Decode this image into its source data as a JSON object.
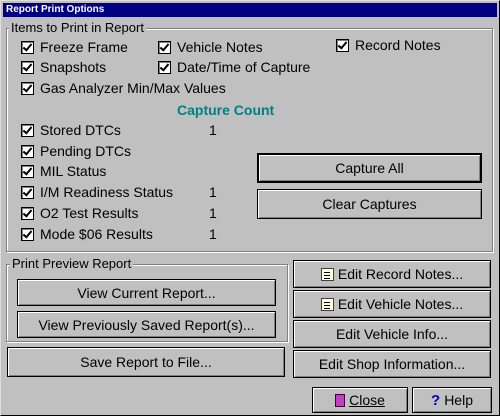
{
  "window": {
    "title": "Report Print Options"
  },
  "items_group": {
    "label": "Items to Print in Report",
    "freeze_frame": "Freeze Frame",
    "vehicle_notes": "Vehicle Notes",
    "record_notes": "Record Notes",
    "snapshots": "Snapshots",
    "date_time": "Date/Time of Capture",
    "gas_analyzer": "Gas Analyzer Min/Max Values",
    "capture_count_label": "Capture Count",
    "stored_dtcs": {
      "label": "Stored DTCs",
      "count": "1"
    },
    "pending_dtcs": {
      "label": "Pending DTCs",
      "count": ""
    },
    "mil_status": {
      "label": "MIL Status",
      "count": ""
    },
    "im_readiness": {
      "label": "I/M Readiness Status",
      "count": "1"
    },
    "o2_test": {
      "label": "O2 Test Results",
      "count": "1"
    },
    "mode06": {
      "label": "Mode $06 Results",
      "count": "1"
    },
    "capture_all": "Capture All",
    "clear_captures": "Clear Captures"
  },
  "preview_group": {
    "label": "Print Preview Report",
    "view_current": "View Current Report...",
    "view_saved": "View Previously Saved Report(s)..."
  },
  "buttons": {
    "save_to_file": "Save Report to File...",
    "edit_record_notes": "Edit Record Notes...",
    "edit_vehicle_notes": "Edit Vehicle Notes...",
    "edit_vehicle_info": "Edit Vehicle Info...",
    "edit_shop_info": "Edit Shop Information...",
    "close": "Close",
    "help": "Help"
  },
  "icons": {
    "note": "notepad-icon",
    "close": "door-icon",
    "help": "question-mark-icon"
  }
}
